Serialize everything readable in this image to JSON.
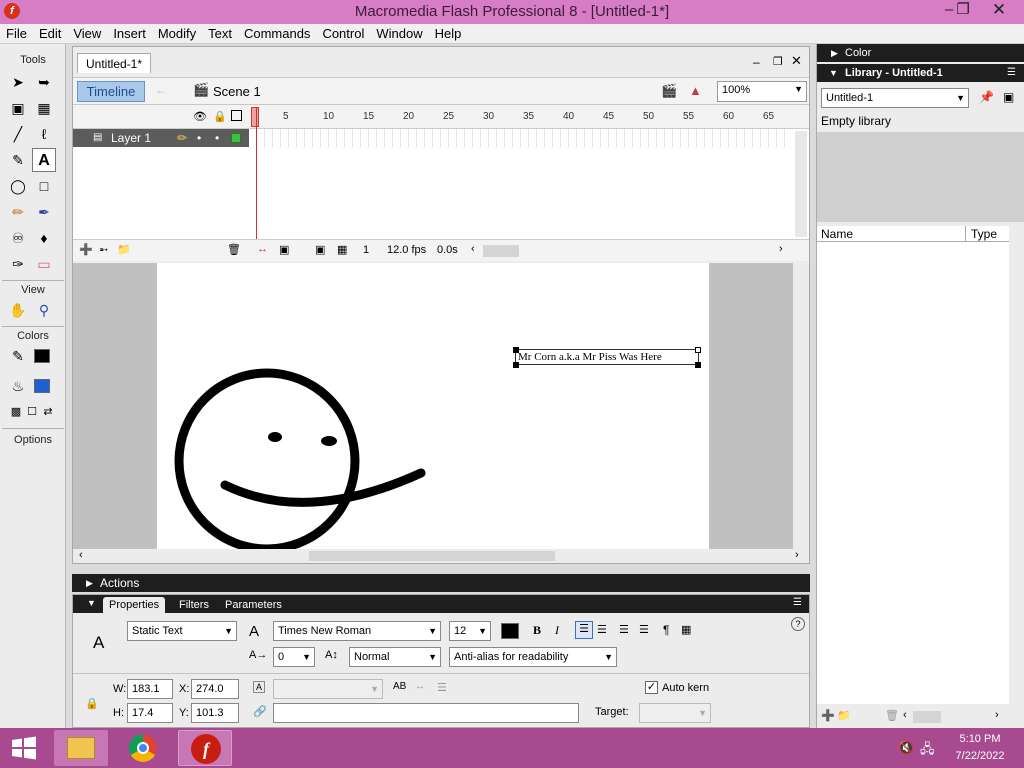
{
  "window": {
    "title": "Macromedia Flash Professional 8 - [Untitled-1*]"
  },
  "menu": [
    "File",
    "Edit",
    "View",
    "Insert",
    "Modify",
    "Text",
    "Commands",
    "Control",
    "Window",
    "Help"
  ],
  "tools": {
    "tools_label": "Tools",
    "view_label": "View",
    "colors_label": "Colors",
    "options_label": "Options",
    "stroke_color": "#000000",
    "fill_color": "#1f5fd0"
  },
  "document": {
    "tab_label": "Untitled-1*",
    "timeline_button": "Timeline",
    "scene_label": "Scene 1",
    "zoom": "100%",
    "ruler_ticks": [
      "1",
      "5",
      "10",
      "15",
      "20",
      "25",
      "30",
      "35",
      "40",
      "45",
      "50",
      "55",
      "60",
      "65"
    ],
    "layer_name": "Layer 1",
    "current_frame": "1",
    "fps": "12.0 fps",
    "elapsed": "0.0s",
    "stage_text": "Mr Corn a.k.a Mr Piss Was Here"
  },
  "actions_panel": {
    "label": "Actions"
  },
  "properties": {
    "tabs": [
      "Properties",
      "Filters",
      "Parameters"
    ],
    "text_type": "Static Text",
    "font": "Times New Roman",
    "font_size": "12",
    "letter_spacing": "0",
    "char_position": "Normal",
    "antialias": "Anti-alias for readability",
    "auto_kern_label": "Auto kern",
    "auto_kern": true,
    "w_label": "W:",
    "w": "183.1",
    "h_label": "H:",
    "h": "17.4",
    "x_label": "X:",
    "x": "274.0",
    "y_label": "Y:",
    "y": "101.3",
    "target_label": "Target:",
    "text_color": "#000000"
  },
  "right_panels": {
    "color_label": "Color",
    "library_label": "Library - Untitled-1",
    "library_select": "Untitled-1",
    "empty_label": "Empty library",
    "col_name": "Name",
    "col_type": "Type"
  },
  "taskbar": {
    "time": "5:10 PM",
    "date": "7/22/2022"
  }
}
